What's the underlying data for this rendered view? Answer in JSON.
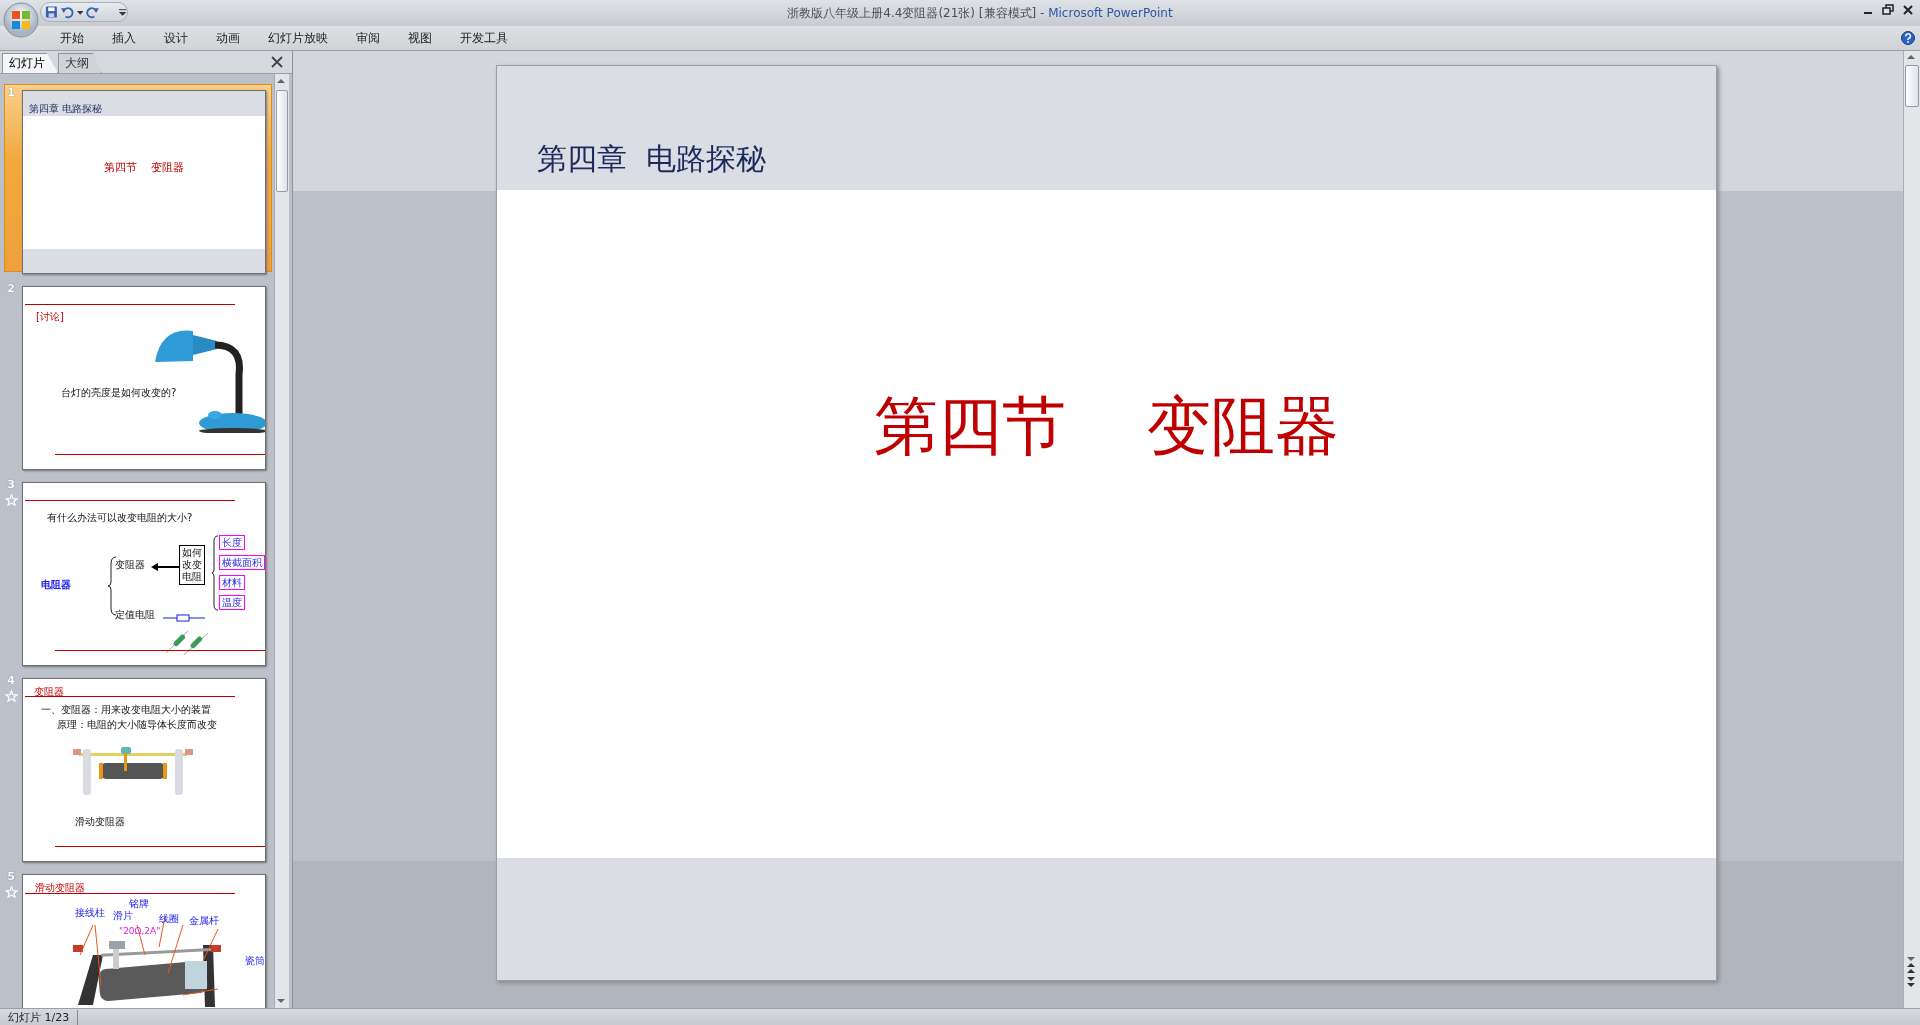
{
  "window": {
    "document": "浙教版八年级上册4.4变阻器(21张) [兼容模式]",
    "app": "- Microsoft PowerPoint"
  },
  "ribbon_tabs": [
    {
      "label": "开始"
    },
    {
      "label": "插入"
    },
    {
      "label": "设计"
    },
    {
      "label": "动画"
    },
    {
      "label": "幻灯片放映"
    },
    {
      "label": "审阅"
    },
    {
      "label": "视图"
    },
    {
      "label": "开发工具"
    }
  ],
  "pane_tabs": [
    {
      "label": "幻灯片",
      "selected": true
    },
    {
      "label": "大纲",
      "selected": false
    }
  ],
  "thumbnails": [
    {
      "number": "1",
      "selected": true,
      "animated": false,
      "kind": "title",
      "header": "第四章 电路探秘",
      "title": "第四节    变阻器"
    },
    {
      "number": "2",
      "selected": false,
      "animated": false,
      "kind": "lamp",
      "tag": "[讨论]",
      "question": "台灯的亮度是如何改变的?"
    },
    {
      "number": "3",
      "selected": false,
      "animated": true,
      "kind": "diagram",
      "question": "有什么办法可以改变电阻的大小?",
      "root": "电阻器",
      "branches": [
        "变阻器",
        "定值电阻"
      ],
      "center": [
        "如何",
        "改变",
        "电阻"
      ],
      "factors": [
        "长度",
        "横截面积",
        "材料",
        "温度"
      ]
    },
    {
      "number": "4",
      "selected": false,
      "animated": true,
      "kind": "rheostat",
      "heading": "变阻器",
      "lines": [
        "一、变阻器：用来改变电阻大小的装置",
        "原理：电阻的大小随导体长度而改变"
      ],
      "caption": "滑动变阻器"
    },
    {
      "number": "5",
      "selected": false,
      "animated": true,
      "kind": "labeled",
      "heading": "滑动变阻器",
      "labels": [
        "接线柱",
        "铭牌",
        "滑片",
        "线圈",
        "金属杆",
        "瓷筒"
      ],
      "rating": "\"20Ω,2A\""
    }
  ],
  "slide": {
    "header": "第四章  电路探秘",
    "title": "第四节    变阻器"
  },
  "status_bar": {
    "slide_indicator": "幻灯片 1/23"
  }
}
